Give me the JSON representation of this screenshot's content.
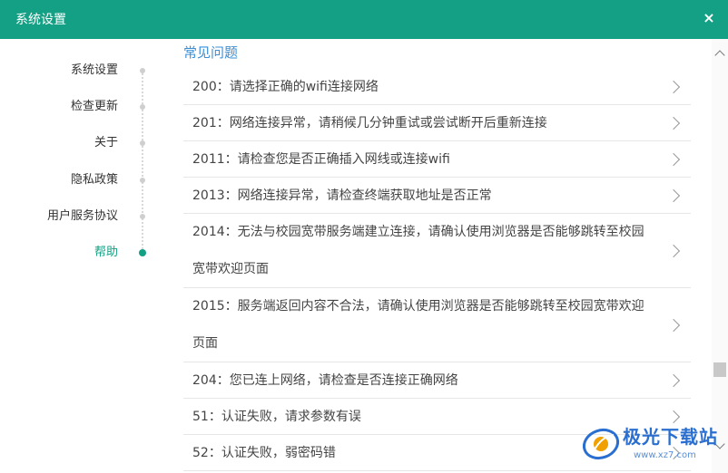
{
  "window": {
    "title": "系统设置",
    "close_icon": "×"
  },
  "sidebar": {
    "items": [
      {
        "label": "系统设置",
        "active": false
      },
      {
        "label": "检查更新",
        "active": false
      },
      {
        "label": "关于",
        "active": false
      },
      {
        "label": "隐私政策",
        "active": false
      },
      {
        "label": "用户服务协议",
        "active": false
      },
      {
        "label": "帮助",
        "active": true
      }
    ]
  },
  "content": {
    "section_title": "常见问题",
    "faq": [
      {
        "text": "200：请选择正确的wifi连接网络"
      },
      {
        "text": "201：网络连接异常，请稍候几分钟重试或尝试断开后重新连接"
      },
      {
        "text": "2011：请检查您是否正确插入网线或连接wifi"
      },
      {
        "text": "2013：网络连接异常，请检查终端获取地址是否正常"
      },
      {
        "text": "2014：无法与校园宽带服务端建立连接，请确认使用浏览器是否能够跳转至校园宽带欢迎页面"
      },
      {
        "text": "2015：服务端返回内容不合法，请确认使用浏览器是否能够跳转至校园宽带欢迎页面"
      },
      {
        "text": "204：您已连上网络，请检查是否连接正确网络"
      },
      {
        "text": "51：认证失败，请求参数有误"
      },
      {
        "text": "52：认证失败，弱密码错"
      }
    ]
  },
  "watermark": {
    "brand": "极光下载站",
    "url": "www.xz7.com"
  },
  "colors": {
    "accent": "#14a084",
    "section_title": "#3a8fd6"
  }
}
